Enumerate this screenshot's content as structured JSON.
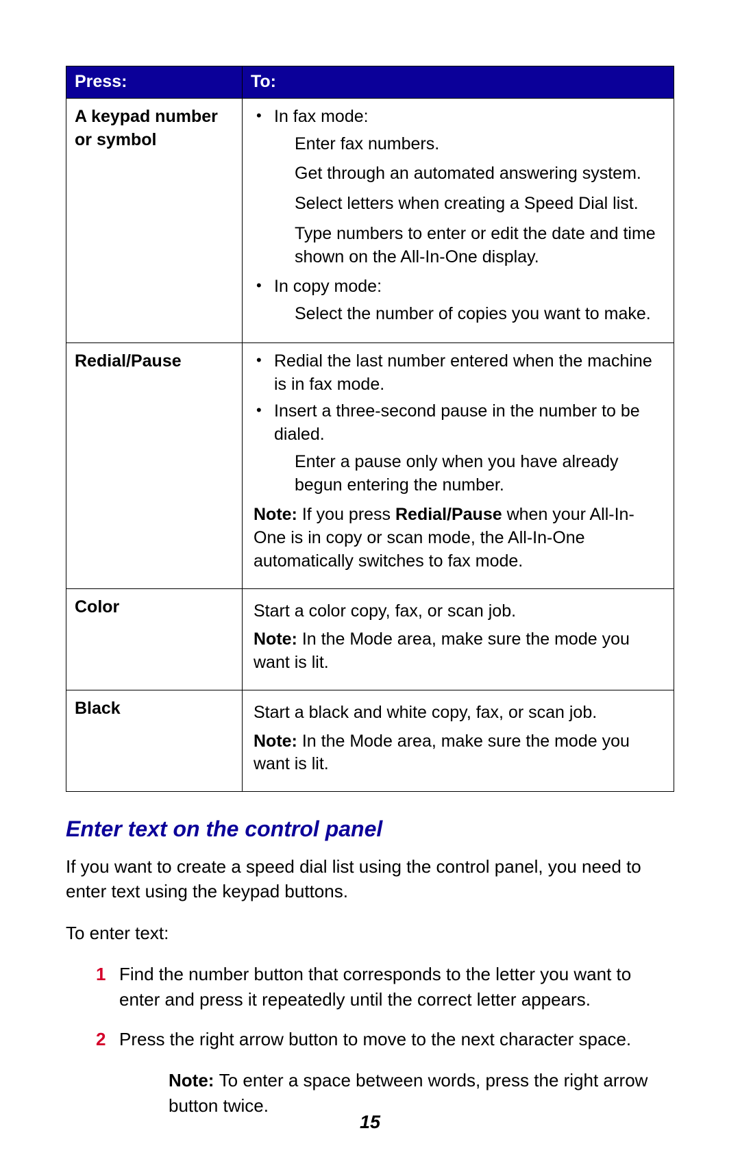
{
  "table": {
    "headers": {
      "press": "Press:",
      "to": "To:"
    },
    "rows": [
      {
        "press_line1": "A keypad number",
        "press_line2": "or symbol",
        "bullets": [
          {
            "lead": "In fax mode:",
            "subs": [
              "Enter fax numbers.",
              "Get through an automated answering system.",
              "Select letters when creating a Speed Dial list.",
              "Type numbers to enter or edit the date and time shown on the All-In-One display."
            ]
          },
          {
            "lead": "In copy mode:",
            "subs": [
              "Select the number of copies you want to make."
            ]
          }
        ]
      },
      {
        "press": "Redial/Pause",
        "bullets": [
          {
            "lead": "Redial the last number entered when the machine is in fax mode."
          },
          {
            "lead": "Insert a three-second pause in the number to be dialed.",
            "subs": [
              "Enter a pause only when you have already begun entering the number."
            ]
          }
        ],
        "note_pre": "Note: ",
        "note_mid1": "If you press ",
        "note_bold": "Redial/Pause",
        "note_mid2": " when your All-In-One is in copy or scan mode, the All-In-One automatically switches to fax mode."
      },
      {
        "press": "Color",
        "body": "Start a color copy, fax, or scan job.",
        "note_pre": "Note: ",
        "note_text": "In the Mode area, make sure the mode you want is lit."
      },
      {
        "press": "Black",
        "body": "Start a black and white copy, fax, or scan job.",
        "note_pre": "Note: ",
        "note_text": "In the Mode area, make sure the mode you want is lit."
      }
    ]
  },
  "section_heading": "Enter text on the control panel",
  "intro": "If you want to create a speed dial list using the control panel, you need to enter text using the keypad buttons.",
  "to_enter": "To enter text:",
  "steps": [
    "Find the number button that corresponds to the letter you want to enter and press it repeatedly until the correct letter appears.",
    "Press the right arrow button to move to the next character space."
  ],
  "step_note_pre": "Note: ",
  "step_note_text": "To enter a space between words, press the right arrow button twice.",
  "page_number": "15"
}
